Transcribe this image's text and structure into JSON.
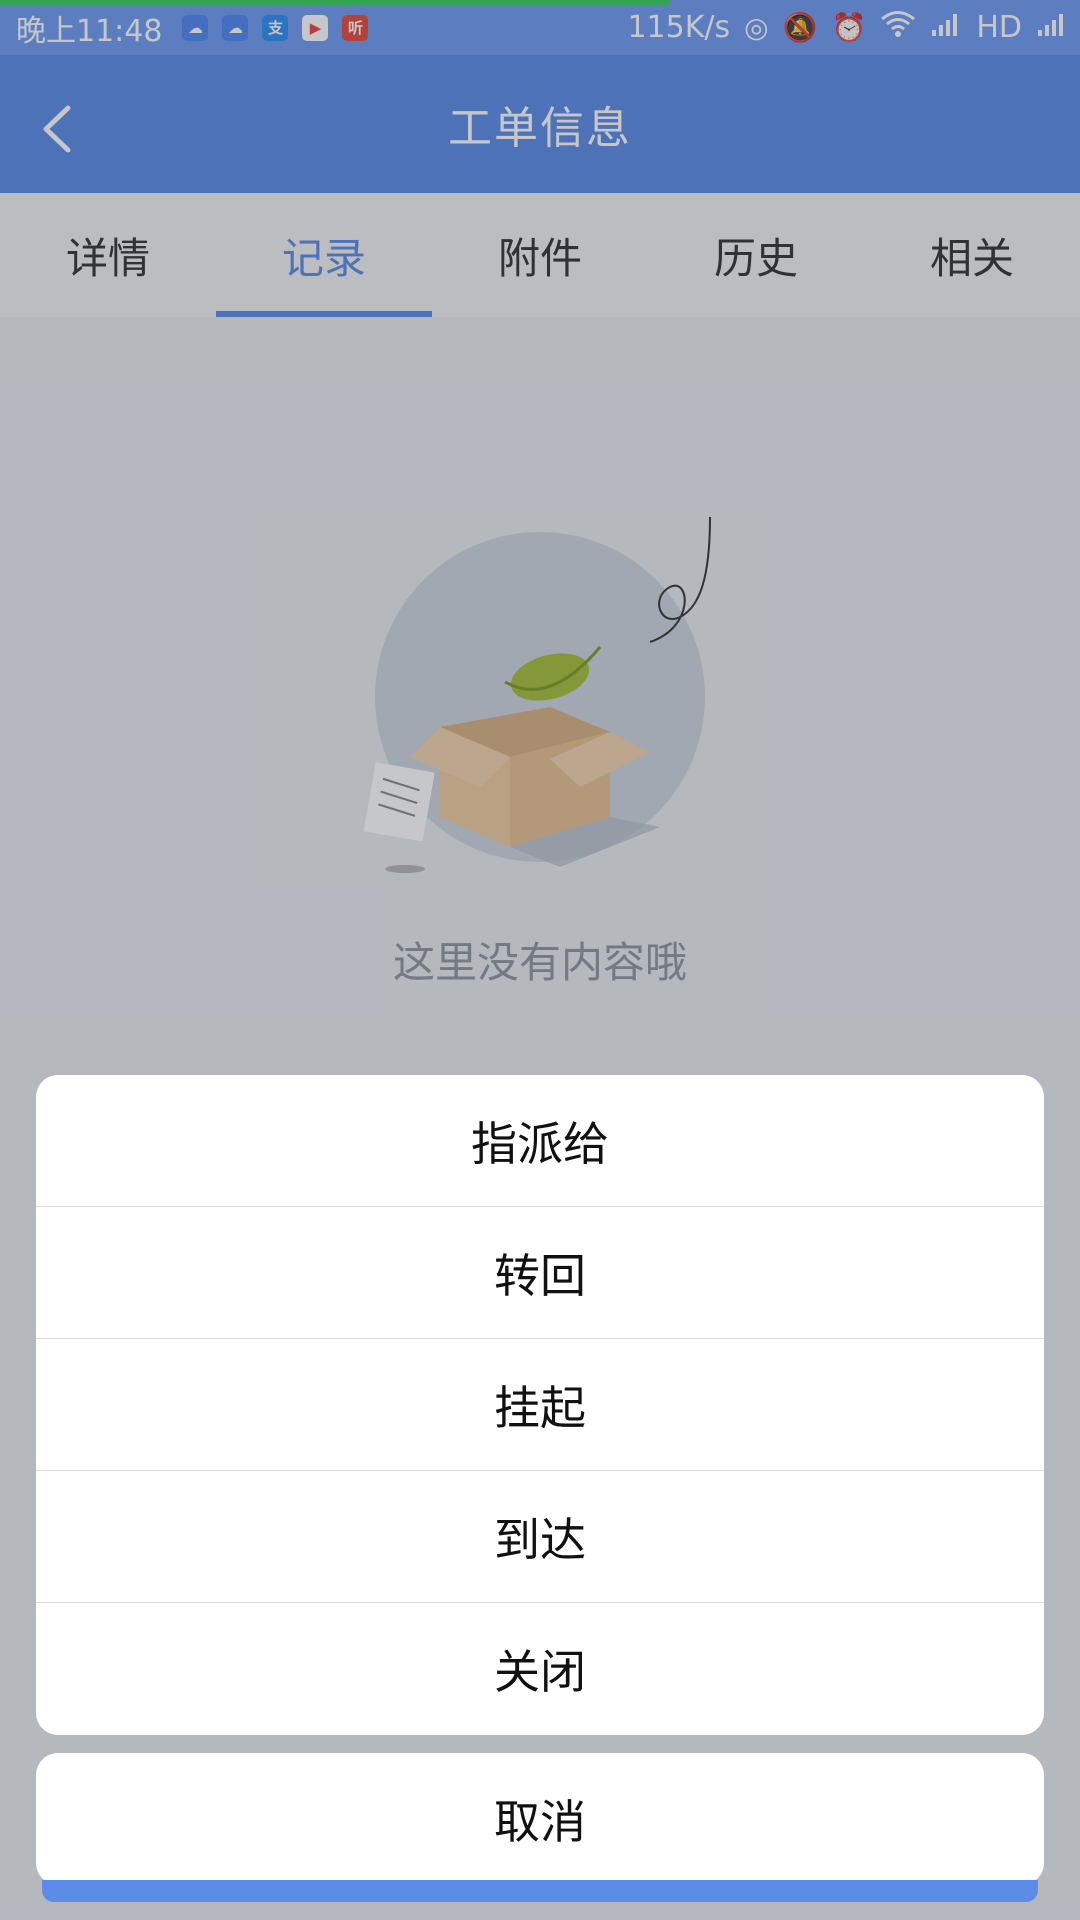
{
  "status_bar": {
    "time": "晚上11:48",
    "app_icons": [
      "cloud-weather-icon",
      "cloud-weather-icon",
      "alipay-icon",
      "play-icon",
      "listen-icon"
    ],
    "listen_label": "听",
    "net_speed": "115K/s",
    "network_type": "HD"
  },
  "app_bar": {
    "title": "工单信息"
  },
  "tabs": [
    {
      "label": "详情"
    },
    {
      "label": "记录"
    },
    {
      "label": "附件"
    },
    {
      "label": "历史"
    },
    {
      "label": "相关"
    }
  ],
  "active_tab": 1,
  "empty_state": {
    "text": "这里没有内容哦"
  },
  "action_sheet": {
    "items": [
      {
        "label": "指派给"
      },
      {
        "label": "转回"
      },
      {
        "label": "挂起"
      },
      {
        "label": "到达"
      },
      {
        "label": "关闭"
      }
    ],
    "cancel_label": "取消"
  },
  "colors": {
    "status_bar": "#6f9cf2",
    "accent": "#5b8be6",
    "progress_line": "#38d05a"
  }
}
